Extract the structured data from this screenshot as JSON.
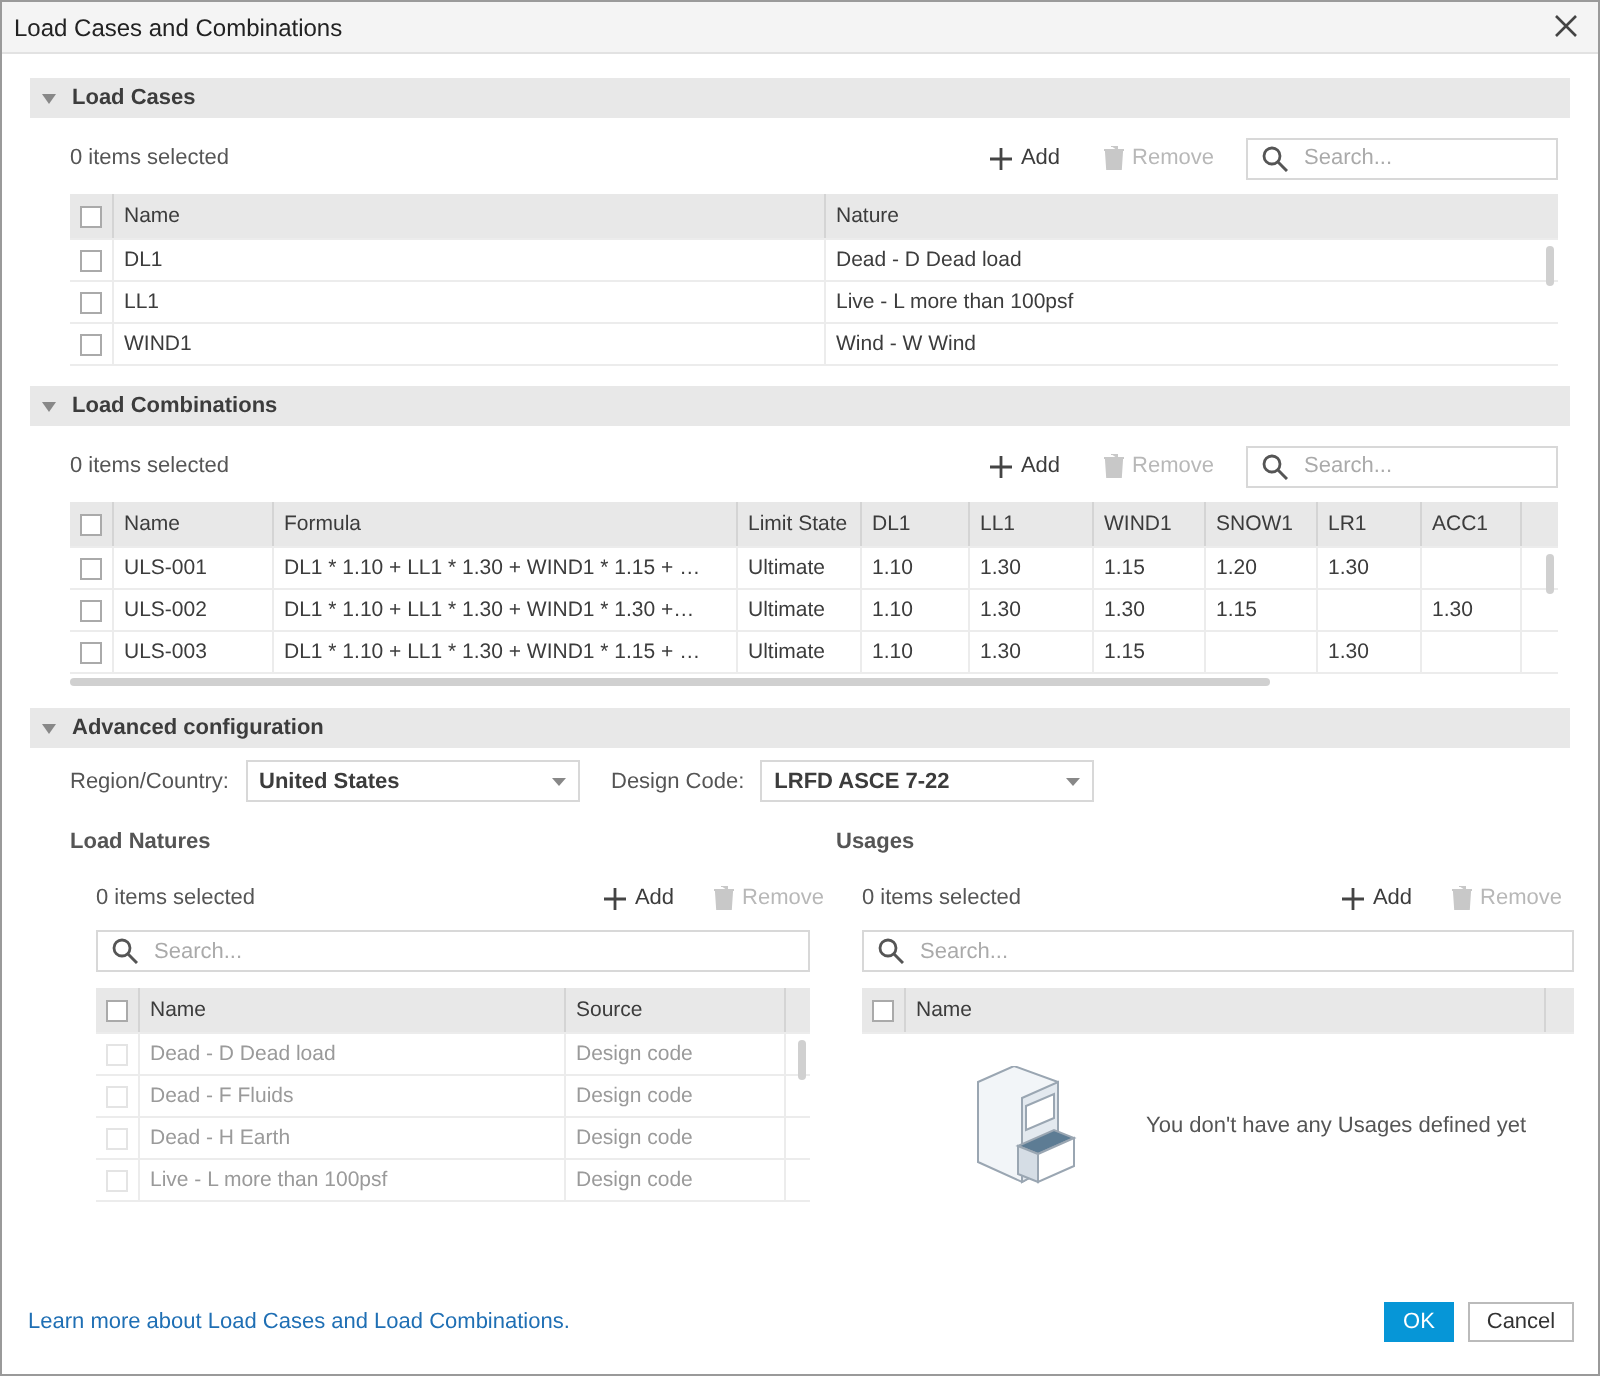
{
  "window": {
    "title": "Load Cases and Combinations"
  },
  "load_cases": {
    "title": "Load Cases",
    "expanded": true,
    "selection": "0 items selected",
    "add": "Add",
    "remove": {
      "label": "Remove",
      "disabled": true
    },
    "search": {
      "placeholder": "Search..."
    },
    "columns": [
      "Name",
      "Nature"
    ],
    "all_selected": false,
    "rows": [
      {
        "selected": false,
        "cells": [
          "DL1",
          "Dead - D Dead load"
        ]
      },
      {
        "selected": false,
        "cells": [
          "LL1",
          "Live - L more than 100psf"
        ]
      },
      {
        "selected": false,
        "cells": [
          "WIND1",
          "Wind - W Wind"
        ]
      }
    ]
  },
  "load_combinations": {
    "title": "Load Combinations",
    "expanded": true,
    "selection": "0 items selected",
    "add": "Add",
    "remove": {
      "label": "Remove",
      "disabled": true
    },
    "search": {
      "placeholder": "Search..."
    },
    "columns": [
      "Name",
      "Formula",
      "Limit State",
      "DL1",
      "LL1",
      "WIND1",
      "SNOW1",
      "LR1",
      "ACC1"
    ],
    "all_selected": false,
    "rows": [
      {
        "selected": false,
        "cells": [
          "ULS-001",
          "DL1 * 1.10 + LL1 * 1.30 + WIND1 * 1.15 + …",
          "Ultimate",
          "1.10",
          "1.30",
          "1.15",
          "1.20",
          "1.30",
          ""
        ]
      },
      {
        "selected": false,
        "cells": [
          "ULS-002",
          "DL1 * 1.10 + LL1 * 1.30 + WIND1 * 1.30 +…",
          "Ultimate",
          "1.10",
          "1.30",
          "1.30",
          "1.15",
          "",
          "1.30"
        ]
      },
      {
        "selected": false,
        "cells": [
          "ULS-003",
          "DL1 * 1.10 + LL1 * 1.30 + WIND1 * 1.15 + …",
          "Ultimate",
          "1.10",
          "1.30",
          "1.15",
          "",
          "1.30",
          ""
        ]
      }
    ]
  },
  "advanced": {
    "title": "Advanced configuration",
    "expanded": true,
    "region": {
      "label": "Region/Country:",
      "value": "United States"
    },
    "design_code": {
      "label": "Design Code:",
      "value": "LRFD ASCE 7-22"
    },
    "load_natures": {
      "title": "Load Natures",
      "selection": "0 items selected",
      "add": "Add",
      "remove": {
        "label": "Remove",
        "disabled": true
      },
      "search": {
        "placeholder": "Search..."
      },
      "columns": [
        "Name",
        "Source"
      ],
      "all_selected": false,
      "rows": [
        {
          "selected": false,
          "disabled": true,
          "cells": [
            "Dead - D Dead load",
            "Design code"
          ]
        },
        {
          "selected": false,
          "disabled": true,
          "cells": [
            "Dead - F Fluids",
            "Design code"
          ]
        },
        {
          "selected": false,
          "disabled": true,
          "cells": [
            "Dead - H Earth",
            "Design code"
          ]
        },
        {
          "selected": false,
          "disabled": true,
          "cells": [
            "Live - L more than 100psf",
            "Design code"
          ]
        }
      ]
    },
    "usages": {
      "title": "Usages",
      "selection": "0 items selected",
      "add": "Add",
      "remove": {
        "label": "Remove",
        "disabled": true
      },
      "search": {
        "placeholder": "Search..."
      },
      "columns": [
        "Name"
      ],
      "all_selected": false,
      "empty_message": "You don't have any Usages defined yet"
    }
  },
  "footer": {
    "link": "Learn more about Load Cases and Load Combinations.",
    "ok": "OK",
    "cancel": "Cancel"
  }
}
